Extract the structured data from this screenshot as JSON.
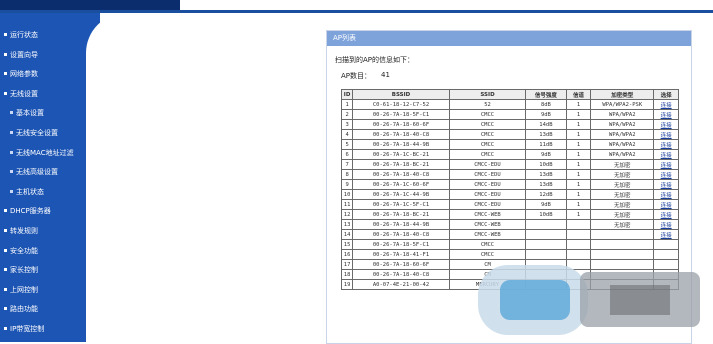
{
  "sidebar": {
    "items": [
      {
        "label": "运行状态",
        "sub": false
      },
      {
        "label": "设置向导",
        "sub": false
      },
      {
        "label": "网络参数",
        "sub": false
      },
      {
        "label": "无线设置",
        "sub": false
      },
      {
        "label": "基本设置",
        "sub": true
      },
      {
        "label": "无线安全设置",
        "sub": true
      },
      {
        "label": "无线MAC地址过滤",
        "sub": true
      },
      {
        "label": "无线高级设置",
        "sub": true
      },
      {
        "label": "主机状态",
        "sub": true
      },
      {
        "label": "DHCP服务器",
        "sub": false
      },
      {
        "label": "转发规则",
        "sub": false
      },
      {
        "label": "安全功能",
        "sub": false
      },
      {
        "label": "家长控制",
        "sub": false
      },
      {
        "label": "上网控制",
        "sub": false
      },
      {
        "label": "路由功能",
        "sub": false
      },
      {
        "label": "IP带宽控制",
        "sub": false
      }
    ]
  },
  "panel": {
    "title": "AP列表",
    "intro": "扫描到的AP的信息如下：",
    "count_label": "AP数目：",
    "count_value": "41"
  },
  "table": {
    "headers": [
      "ID",
      "BSSID",
      "SSID",
      "信号强度",
      "信道",
      "加密类型",
      "选择"
    ],
    "rows": [
      [
        "1",
        "C0-61-18-12-C7-52",
        "52",
        "8dB",
        "1",
        "WPA/WPA2-PSK",
        "连接"
      ],
      [
        "2",
        "00-26-7A-18-5F-C1",
        "CMCC",
        "9dB",
        "1",
        "WPA/WPA2",
        "连接"
      ],
      [
        "3",
        "00-26-7A-18-60-6F",
        "CMCC",
        "14dB",
        "1",
        "WPA/WPA2",
        "连接"
      ],
      [
        "4",
        "00-26-7A-18-40-C8",
        "CMCC",
        "13dB",
        "1",
        "WPA/WPA2",
        "连接"
      ],
      [
        "5",
        "00-26-7A-18-44-9B",
        "CMCC",
        "11dB",
        "1",
        "WPA/WPA2",
        "连接"
      ],
      [
        "6",
        "00-26-7A-1C-BC-21",
        "CMCC",
        "9dB",
        "1",
        "WPA/WPA2",
        "连接"
      ],
      [
        "7",
        "00-26-7A-18-BC-21",
        "CMCC-EDU",
        "10dB",
        "1",
        "无加密",
        "连接"
      ],
      [
        "8",
        "00-26-7A-18-40-C8",
        "CMCC-EDU",
        "13dB",
        "1",
        "无加密",
        "连接"
      ],
      [
        "9",
        "00-26-7A-1C-60-6F",
        "CMCC-EDU",
        "13dB",
        "1",
        "无加密",
        "连接"
      ],
      [
        "10",
        "00-26-7A-1C-44-9B",
        "CMCC-EDU",
        "12dB",
        "1",
        "无加密",
        "连接"
      ],
      [
        "11",
        "00-26-7A-1C-5F-C1",
        "CMCC-EDU",
        "9dB",
        "1",
        "无加密",
        "连接"
      ],
      [
        "12",
        "00-26-7A-18-BC-21",
        "CMCC-WEB",
        "10dB",
        "1",
        "无加密",
        "连接"
      ],
      [
        "13",
        "00-26-7A-18-44-9B",
        "CMCC-WEB",
        "",
        "",
        "无加密",
        "连接"
      ],
      [
        "14",
        "00-26-7A-18-40-C8",
        "CMCC-WEB",
        "",
        "",
        "",
        "连接"
      ],
      [
        "15",
        "00-26-7A-18-5F-C1",
        "CMCC",
        "",
        "",
        "",
        ""
      ],
      [
        "16",
        "00-26-7A-18-41-F1",
        "CMCC",
        "",
        "",
        "",
        ""
      ],
      [
        "17",
        "00-26-7A-18-60-6F",
        "CM",
        "",
        "",
        "",
        ""
      ],
      [
        "18",
        "00-26-7A-18-40-C8",
        "CM",
        "",
        "",
        "",
        ""
      ],
      [
        "19",
        "A0-07-4E-21-00-42",
        "MERCURY",
        "",
        "",
        "",
        ""
      ]
    ]
  },
  "colors": {
    "sidebar": "#1d55b4",
    "panel_title": "#7ea3da",
    "link": "#1a3f9a"
  }
}
